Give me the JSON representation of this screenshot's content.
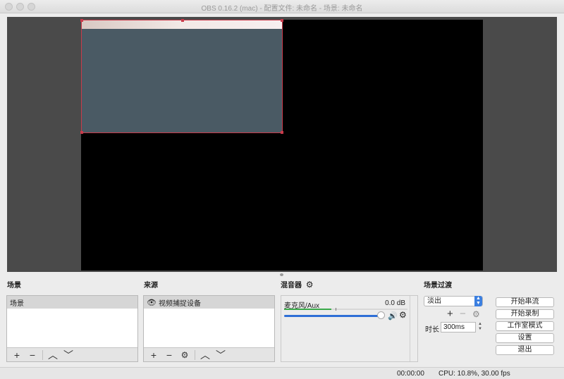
{
  "window": {
    "title": "OBS 0.16.2 (mac) - 配置文件: 未命名 - 场景: 未命名"
  },
  "docks": {
    "scenes": {
      "title": "场景",
      "items": [
        "场景"
      ],
      "toolbar_icons": [
        "plus-icon",
        "minus-icon",
        "chevron-up-icon",
        "chevron-down-icon"
      ]
    },
    "sources": {
      "title": "来源",
      "items": [
        "视频捕捉设备"
      ],
      "toolbar_icons": [
        "plus-icon",
        "minus-icon",
        "gear-icon",
        "chevron-up-icon",
        "chevron-down-icon"
      ]
    },
    "mixer": {
      "title": "混音器",
      "channel": {
        "name": "麦克风/Aux",
        "db": "0.0 dB",
        "level": 0.38,
        "volume": 0.8
      }
    },
    "transitions": {
      "title": "场景过渡",
      "selected": "淡出",
      "duration_label": "时长",
      "duration_value": "300ms"
    }
  },
  "controls": {
    "start_streaming": "开始串流",
    "start_recording": "开始录制",
    "studio_mode": "工作室模式",
    "settings": "设置",
    "exit": "退出"
  },
  "status": {
    "time": "00:00:00",
    "cpu": "CPU: 10.8%, 30.00 fps"
  },
  "colors": {
    "selection": "#c93b4b",
    "accent": "#2e6fd6",
    "meter": "#3aa94a"
  }
}
